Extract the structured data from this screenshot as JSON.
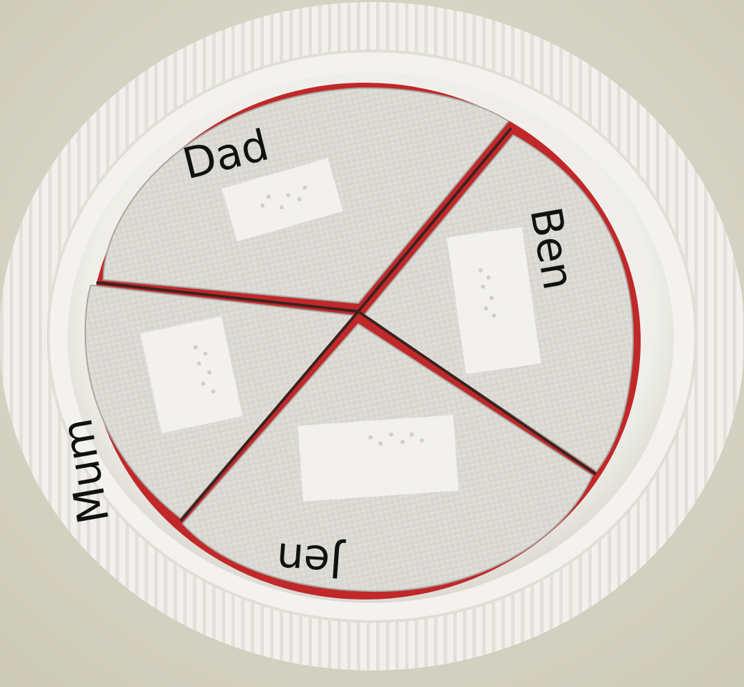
{
  "scene": {
    "subject": "paper-plate-with-cardboard-wheel",
    "colors": {
      "background": "#d9d6c6",
      "plate": "#f4f3ef",
      "plate_shadow": "#c9c7bd",
      "cardboard": "#dedcd7",
      "cardboard_edge": "#b8b5ae",
      "red_backing": "#c0282a",
      "braille_label": "#f2f1ee",
      "ink": "#111111"
    }
  },
  "segments": [
    {
      "name": "Dad",
      "icon": "braille-label"
    },
    {
      "name": "Ben",
      "icon": "braille-label"
    },
    {
      "name": "Jen",
      "icon": "braille-label"
    },
    {
      "name": "Mum",
      "icon": "braille-label"
    }
  ]
}
